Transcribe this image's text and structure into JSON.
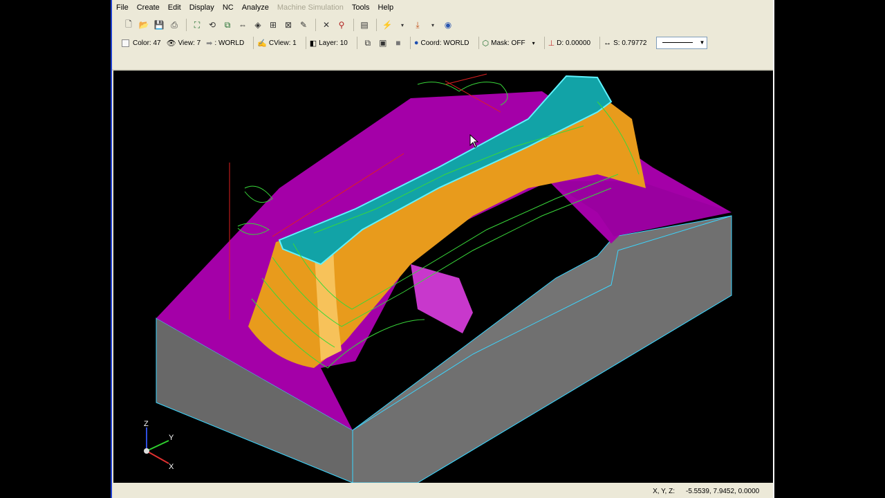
{
  "menus": [
    "File",
    "Create",
    "Edit",
    "Display",
    "NC",
    "Analyze",
    "Machine Simulation",
    "Tools",
    "Help"
  ],
  "menus_disabled": [
    "Machine Simulation"
  ],
  "toolbar_icons": [
    "new-file-icon",
    "open-icon",
    "save-icon",
    "print-icon",
    "fit-icon",
    "rotate-icon",
    "pan-icon",
    "zoom-icon",
    "zoom-window-icon",
    "zoom-in-icon",
    "zoom-out-icon",
    "paint-icon",
    "delete-icon",
    "measure-icon",
    "layer-manager-icon",
    "dimension-icon",
    "snap-icon",
    "render-icon"
  ],
  "status_line": {
    "color_label": "Color: 47",
    "view_label": "View: 7",
    "tool_view_label": ": WORLD",
    "cview_label": "CView: 1",
    "layer_label": "Layer: 10",
    "coord_label": "Coord: WORLD",
    "mask_label": "Mask: OFF",
    "depth_label": "D: 0.00000",
    "s_label": "S: 0.79772"
  },
  "statusbar": {
    "xyz_label": "X, Y, Z:",
    "xyz_value": "-5.5539, 7.9452, 0.0000"
  },
  "triad": {
    "z": "Z",
    "y": "Y",
    "x": "X"
  },
  "colors": {
    "magenta": "#a400a8",
    "gray": "#6e6e6e",
    "teal": "#12a3a7",
    "orange": "#e89b1c",
    "toolpath_green": "#39d83a",
    "edge_cyan": "#3bd6ff"
  }
}
